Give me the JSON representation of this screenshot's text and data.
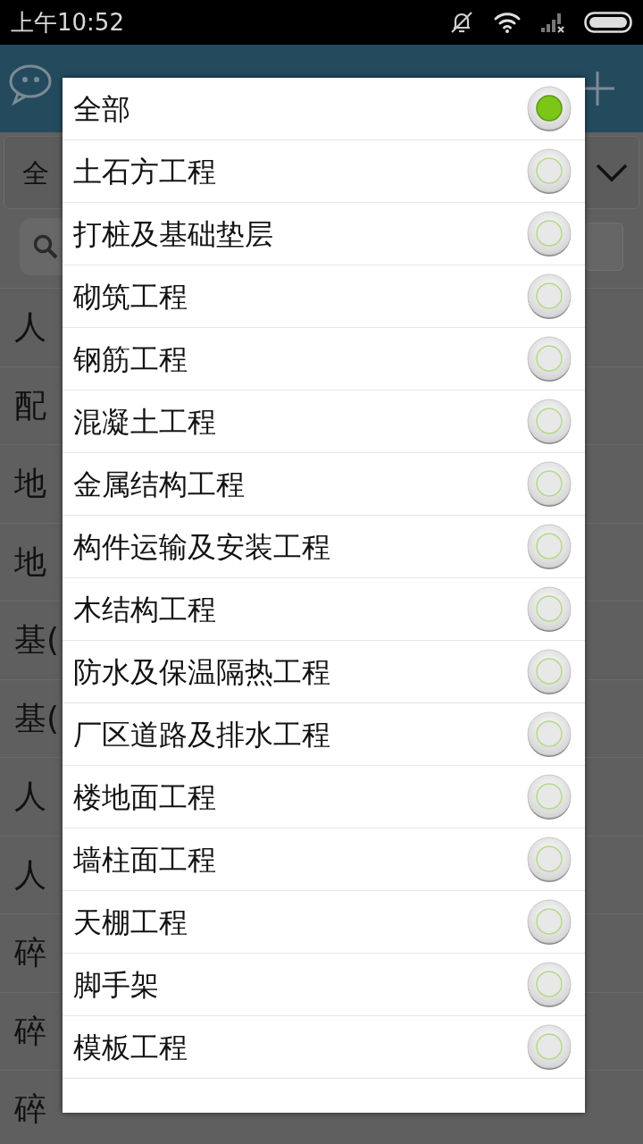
{
  "status_bar": {
    "time": "上午10:52"
  },
  "background": {
    "category_select": {
      "value": "全"
    },
    "list": [
      {
        "text": "人"
      },
      {
        "text": "配"
      },
      {
        "text": "地"
      },
      {
        "text": "地"
      },
      {
        "text": "基("
      },
      {
        "text": "基("
      },
      {
        "text": "人"
      },
      {
        "text": "人"
      },
      {
        "text": "碎"
      },
      {
        "text": "碎"
      },
      {
        "text": "碎"
      }
    ]
  },
  "dialog": {
    "options": [
      {
        "label": "全部",
        "selected": true
      },
      {
        "label": "土石方工程",
        "selected": false
      },
      {
        "label": "打桩及基础垫层",
        "selected": false
      },
      {
        "label": "砌筑工程",
        "selected": false
      },
      {
        "label": "钢筋工程",
        "selected": false
      },
      {
        "label": "混凝土工程",
        "selected": false
      },
      {
        "label": "金属结构工程",
        "selected": false
      },
      {
        "label": "构件运输及安装工程",
        "selected": false
      },
      {
        "label": "木结构工程",
        "selected": false
      },
      {
        "label": "防水及保温隔热工程",
        "selected": false
      },
      {
        "label": "厂区道路及排水工程",
        "selected": false
      },
      {
        "label": "楼地面工程",
        "selected": false
      },
      {
        "label": "墙柱面工程",
        "selected": false
      },
      {
        "label": "天棚工程",
        "selected": false
      },
      {
        "label": "脚手架",
        "selected": false
      },
      {
        "label": "模板工程",
        "selected": false
      }
    ]
  }
}
